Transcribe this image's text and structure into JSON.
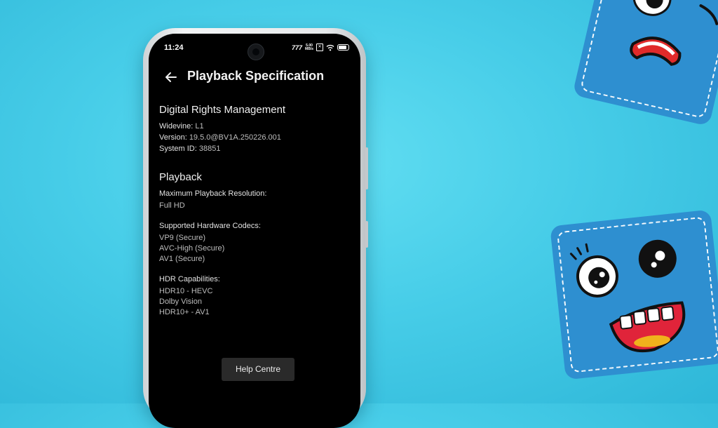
{
  "status": {
    "time": "11:24",
    "network": "777",
    "speed_top": "5.00",
    "speed_bottom": "MB/s",
    "battery_level": 0.85
  },
  "appbar": {
    "title": "Playback Specification"
  },
  "drm": {
    "heading": "Digital Rights Management",
    "widevine_label": "Widevine:",
    "widevine_value": "L1",
    "version_label": "Version:",
    "version_value": "19.5.0@BV1A.250226.001",
    "system_id_label": "System ID:",
    "system_id_value": "38851"
  },
  "playback": {
    "heading": "Playback",
    "max_res_label": "Maximum Playback Resolution:",
    "max_res_value": "Full HD",
    "codecs_label": "Supported Hardware Codecs:",
    "codecs": [
      "VP9 (Secure)",
      "AVC-High (Secure)",
      "AV1 (Secure)"
    ],
    "hdr_label": "HDR Capabilities:",
    "hdr": [
      "HDR10 - HEVC",
      "Dolby Vision",
      "HDR10+ - AV1"
    ]
  },
  "help_button": "Help Centre",
  "colors": {
    "background": "#47cde8",
    "screen": "#000000",
    "sticker": "#2e8fd0",
    "button": "#2a2a2a"
  }
}
